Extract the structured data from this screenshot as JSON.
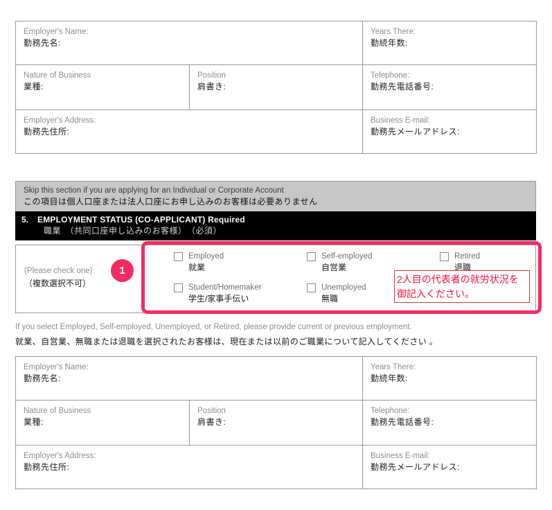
{
  "colors": {
    "accent_pink": "#f72a62",
    "annotation_red": "#f5103c",
    "banner_gray": "#c7c7c7",
    "header_black": "#000000",
    "border_gray": "#9a9a9a"
  },
  "employer_table": {
    "rows": [
      {
        "cells": [
          {
            "en": "Employer's Name:",
            "jp": "勤務先名:"
          },
          {
            "en": "Years There:",
            "jp": "勤続年数:"
          }
        ]
      },
      {
        "cells": [
          {
            "en": "Nature of Business",
            "jp": "業種:"
          },
          {
            "en": "Position",
            "jp": "肩書き:"
          },
          {
            "en": "Telephone:",
            "jp": "勤務先電話番号:"
          }
        ]
      },
      {
        "cells": [
          {
            "en": "Employer's Address:",
            "jp": "勤務先住所:"
          },
          {
            "en": "Business E-mail:",
            "jp": "勤務先メールアドレス:"
          }
        ]
      }
    ]
  },
  "skip_banner": {
    "en": "Skip this section if you are applying for an Individual or Corporate Account",
    "jp": "この項目は個人口座または法人口座にお申し込みのお客様は必要ありません"
  },
  "section_header": {
    "number": "5.",
    "title_en": "EMPLOYMENT STATUS  (CO-APPLICANT)  Required",
    "title_jp": "職業　（共同口座申し込みのお客様）　（必須）"
  },
  "employment_status": {
    "check_one_en": "(Please check one)",
    "check_one_jp": "（複数選択不可）",
    "options": [
      {
        "en": "Employed",
        "jp": "就業"
      },
      {
        "en": "Self-employed",
        "jp": "自営業"
      },
      {
        "en": "Retired",
        "jp": "退職"
      },
      {
        "en": "Student/Homemaker",
        "jp": "学生/家事手伝い"
      },
      {
        "en": "Unemployed",
        "jp": "無職"
      }
    ]
  },
  "badge": {
    "number": "1"
  },
  "annotation": {
    "line1": "2人目の代表者の就労状況を",
    "line2": "御記入ください。"
  },
  "instructions": {
    "en": "If you select Employed, Self-employed, Unemployed, or Retired, please provide current or previous employment.",
    "jp": "就業、自営業、無職または退職を選択されたお客様は、現在または以前のご職業について記入してください 。"
  }
}
